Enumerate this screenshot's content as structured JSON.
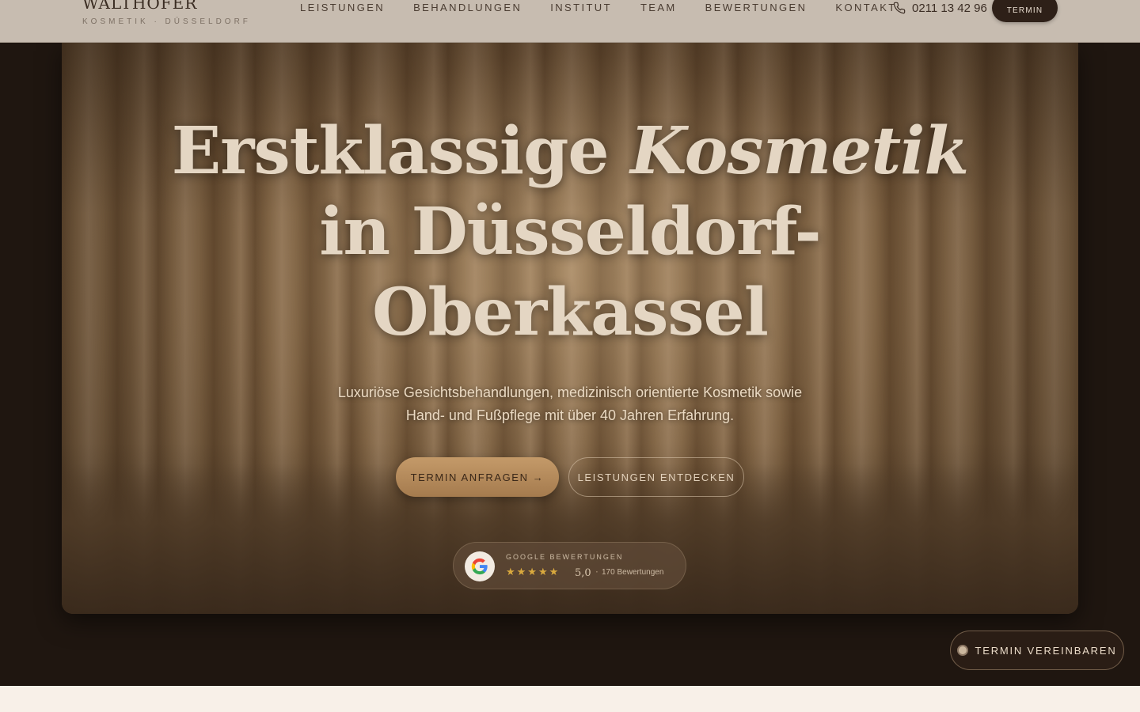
{
  "header": {
    "logo": "WALTHOFER",
    "logo_sub": "KOSMETIK · DÜSSELDORF",
    "nav": [
      "LEISTUNGEN",
      "BEHANDLUNGEN",
      "INSTITUT",
      "TEAM",
      "BEWERTUNGEN",
      "KONTAKT"
    ],
    "phone": "0211 13 42 96",
    "cta": "TERMIN"
  },
  "hero": {
    "title_line1_plain": "Erstklassige ",
    "title_line1_em": "Kosmetik",
    "title_line2": "in Düsseldorf-",
    "title_line3": "Oberkassel",
    "subtitle_line1": "Luxuriöse Gesichtsbehandlungen, medizinisch orientierte Kosmetik sowie",
    "subtitle_line2": "Hand- und Fußpflege mit über 40 Jahren Erfahrung.",
    "primary_cta": "TERMIN ANFRAGEN →",
    "secondary_cta": "LEISTUNGEN ENTDECKEN"
  },
  "reviews": {
    "label": "GOOGLE BEWERTUNGEN",
    "stars": "★★★★★",
    "rating": "5,0",
    "separator": "·",
    "count": "170 Bewertungen"
  },
  "floating": {
    "label": "TERMIN VEREINBAREN"
  },
  "colors": {
    "header_bg": "#c7bcb0",
    "hero_bg": "#1f1610",
    "accent": "#c49a69",
    "star": "#d9a93e"
  }
}
